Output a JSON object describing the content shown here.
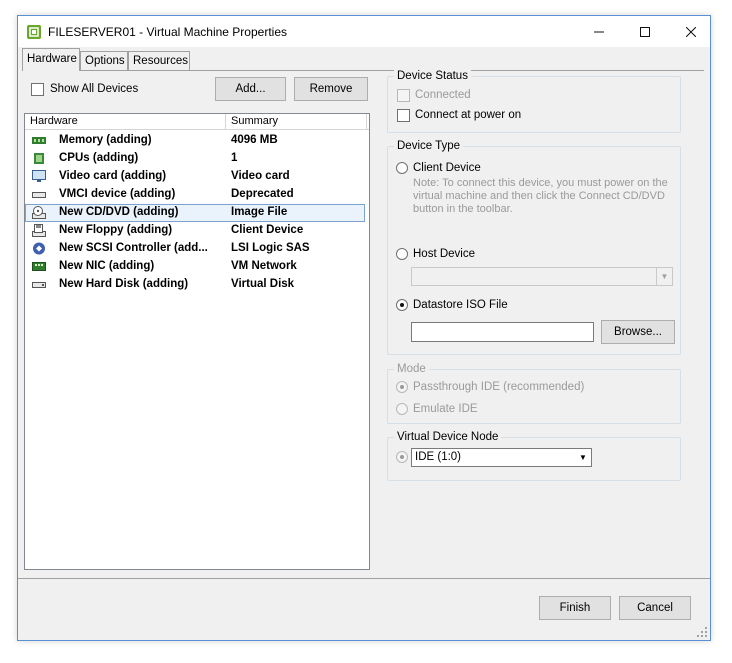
{
  "window": {
    "title": "FILESERVER01 - Virtual Machine Properties",
    "controls": {
      "minimize": "—",
      "maximize": "☐",
      "close": "✕"
    }
  },
  "tabs": [
    {
      "label": "Hardware",
      "active": true
    },
    {
      "label": "Options",
      "active": false
    },
    {
      "label": "Resources",
      "active": false
    }
  ],
  "hardware_panel": {
    "show_all_devices_label": "Show All Devices",
    "show_all_devices_checked": false,
    "add_button": "Add...",
    "remove_button": "Remove",
    "columns": [
      "Hardware",
      "Summary"
    ],
    "rows": [
      {
        "hardware": "Memory (adding)",
        "summary": "4096 MB",
        "icon": "memory-icon",
        "selected": false
      },
      {
        "hardware": "CPUs (adding)",
        "summary": "1",
        "icon": "cpu-icon",
        "selected": false
      },
      {
        "hardware": "Video card  (adding)",
        "summary": "Video card",
        "icon": "monitor-icon",
        "selected": false
      },
      {
        "hardware": "VMCI device (adding)",
        "summary": "Deprecated",
        "icon": "vmci-icon",
        "selected": false
      },
      {
        "hardware": "New CD/DVD (adding)",
        "summary": "Image File",
        "icon": "cd-dvd-icon",
        "selected": true
      },
      {
        "hardware": "New Floppy (adding)",
        "summary": "Client Device",
        "icon": "floppy-icon",
        "selected": false
      },
      {
        "hardware": "New SCSI Controller (add...",
        "summary": "LSI Logic SAS",
        "icon": "scsi-icon",
        "selected": false
      },
      {
        "hardware": "New NIC (adding)",
        "summary": "VM Network",
        "icon": "nic-icon",
        "selected": false
      },
      {
        "hardware": "New Hard Disk (adding)",
        "summary": "Virtual Disk",
        "icon": "hard-disk-icon",
        "selected": false
      }
    ]
  },
  "device_status": {
    "title": "Device Status",
    "connected_label": "Connected",
    "connected_checked": false,
    "connect_at_power_on_label": "Connect at power on",
    "connect_at_power_on_checked": false
  },
  "device_type": {
    "title": "Device Type",
    "client_device_label": "Client Device",
    "client_note": "Note: To connect this device, you must power on the virtual machine and then click the Connect CD/DVD button in the toolbar.",
    "host_device_label": "Host Device",
    "host_device_value": "",
    "datastore_iso_label": "Datastore ISO File",
    "datastore_iso_value": "",
    "browse_button": "Browse...",
    "selected": "datastore_iso"
  },
  "mode": {
    "title": "Mode",
    "passthrough_label": "Passthrough IDE (recommended)",
    "emulate_label": "Emulate IDE",
    "selected": "passthrough"
  },
  "virtual_device_node": {
    "title": "Virtual Device Node",
    "value": "IDE (1:0)"
  },
  "footer": {
    "finish_button": "Finish",
    "cancel_button": "Cancel"
  }
}
